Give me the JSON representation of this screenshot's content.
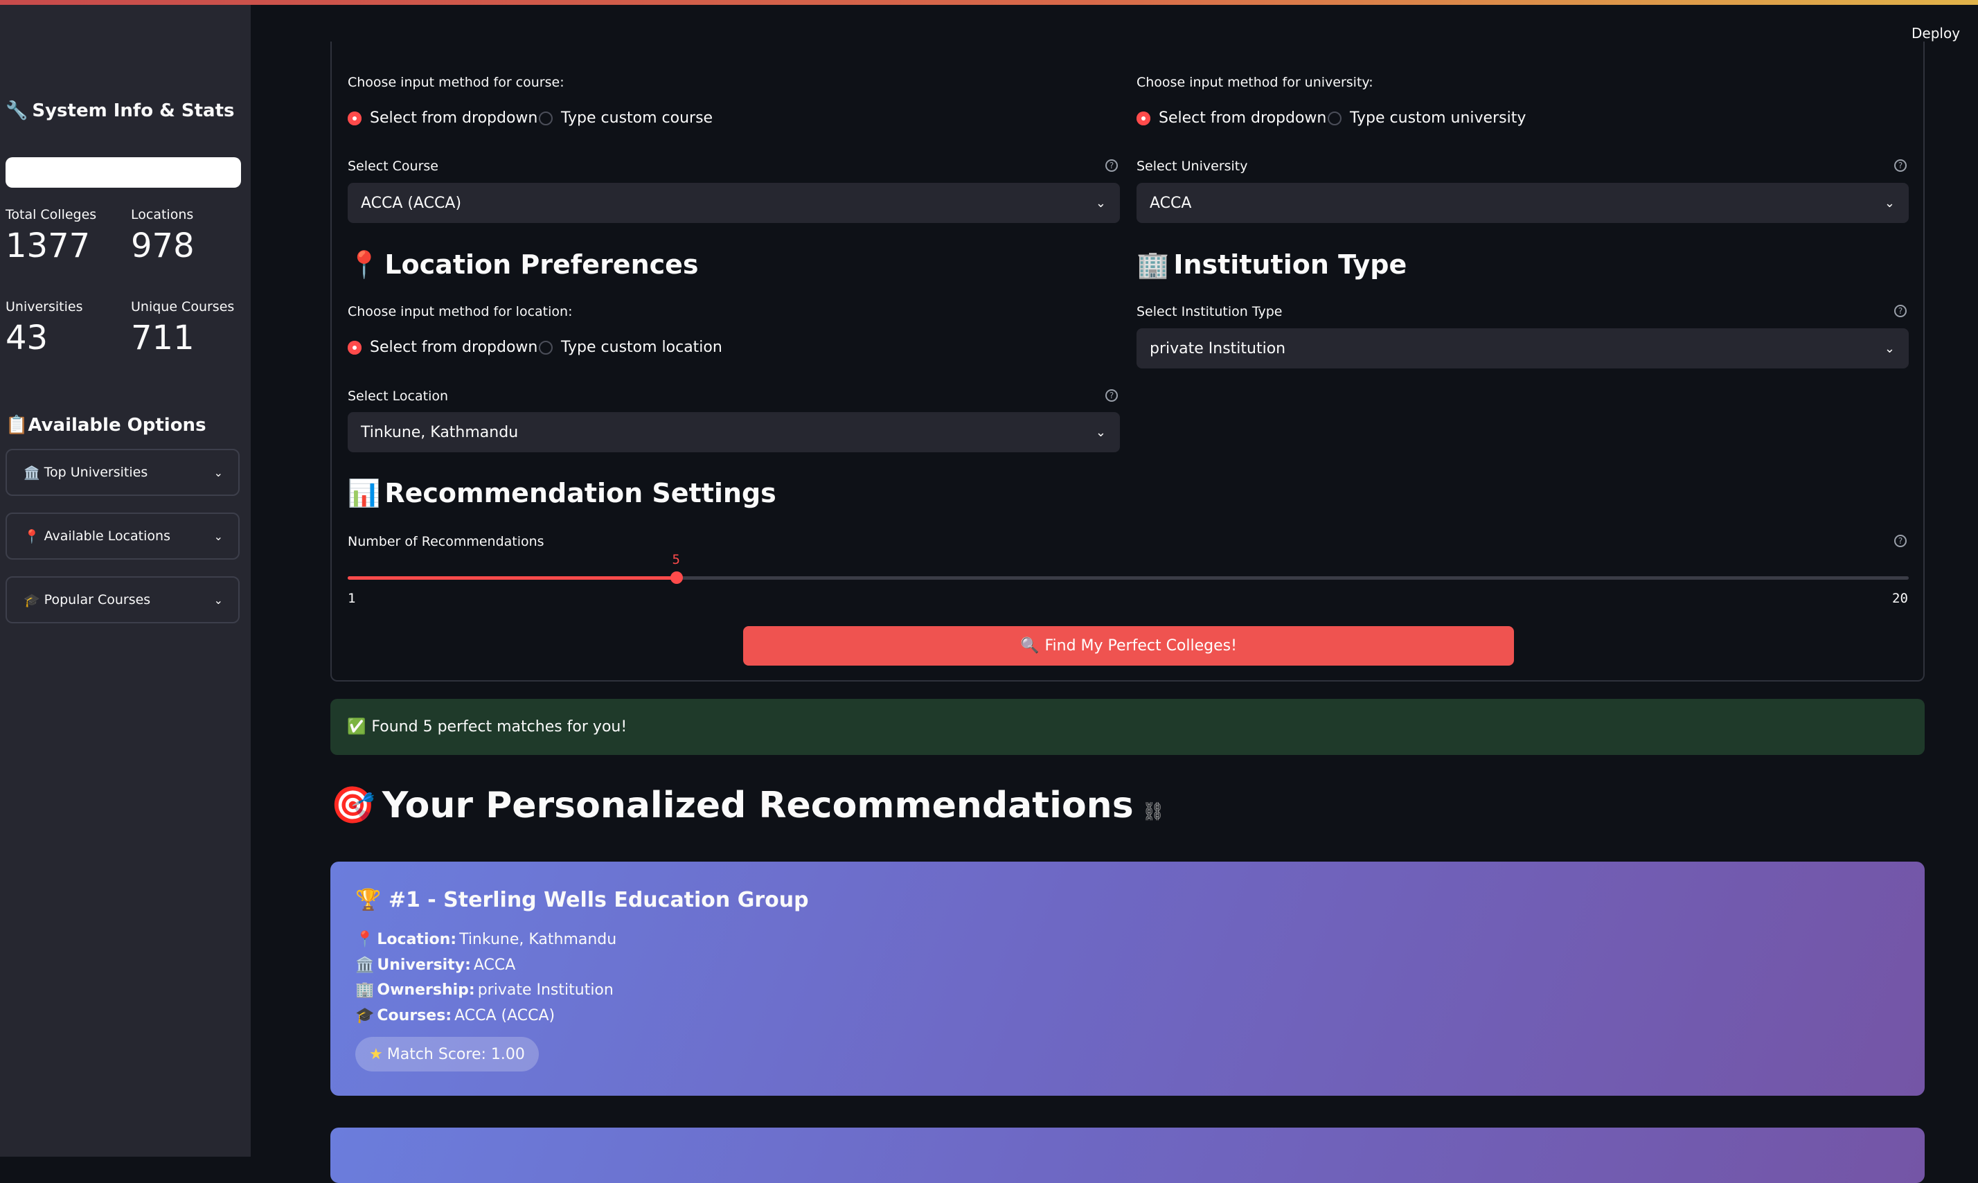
{
  "header": {
    "deploy_label": "Deploy"
  },
  "sidebar": {
    "title": "System Info & Stats",
    "stats": [
      {
        "label": "Total Colleges",
        "value": "1377"
      },
      {
        "label": "Locations",
        "value": "978"
      },
      {
        "label": "Universities",
        "value": "43"
      },
      {
        "label": "Unique Courses",
        "value": "711"
      }
    ],
    "options_title": "Available Options",
    "expanders": [
      {
        "label": "Top Universities",
        "icon": "classical-building-icon"
      },
      {
        "label": "Available Locations",
        "icon": "pin-icon"
      },
      {
        "label": "Popular Courses",
        "icon": "graduation-cap-icon"
      }
    ]
  },
  "course": {
    "method_label": "Choose input method for course:",
    "radio_options": [
      "Select from dropdown",
      "Type custom course"
    ],
    "selected_radio": "Select from dropdown",
    "select_label": "Select Course",
    "select_value": "ACCA (ACCA)"
  },
  "university": {
    "method_label": "Choose input method for university:",
    "radio_options": [
      "Select from dropdown",
      "Type custom university"
    ],
    "selected_radio": "Select from dropdown",
    "select_label": "Select University",
    "select_value": "ACCA"
  },
  "location": {
    "heading": "Location Preferences",
    "method_label": "Choose input method for location:",
    "radio_options": [
      "Select from dropdown",
      "Type custom location"
    ],
    "selected_radio": "Select from dropdown",
    "select_label": "Select Location",
    "select_value": "Tinkune, Kathmandu"
  },
  "institution": {
    "heading": "Institution Type",
    "select_label": "Select Institution Type",
    "select_value": "private Institution"
  },
  "settings": {
    "heading": "Recommendation Settings",
    "slider_label": "Number of Recommendations",
    "slider_value": 5,
    "slider_min": 1,
    "slider_max": 20,
    "slider_value_text": "5",
    "slider_min_text": "1",
    "slider_max_text": "20"
  },
  "find_button": "Find My Perfect Colleges!",
  "success_message": "Found 5 perfect matches for you!",
  "recommendations": {
    "heading": "Your Personalized Recommendations",
    "items": [
      {
        "title": "#1 - Sterling Wells Education Group",
        "location_key": "Location:",
        "location": "Tinkune, Kathmandu",
        "university_key": "University:",
        "university": "ACCA",
        "ownership_key": "Ownership:",
        "ownership": "private Institution",
        "courses_key": "Courses:",
        "courses": "ACCA (ACCA)",
        "match_score": "Match Score: 1.00"
      }
    ]
  },
  "colors": {
    "accent": "#ff4b4b",
    "background": "#0e1117",
    "sidebar": "#262730",
    "success_bg": "#1f3a2a",
    "card_start": "#6b7ddc",
    "card_end": "#7455a6"
  }
}
